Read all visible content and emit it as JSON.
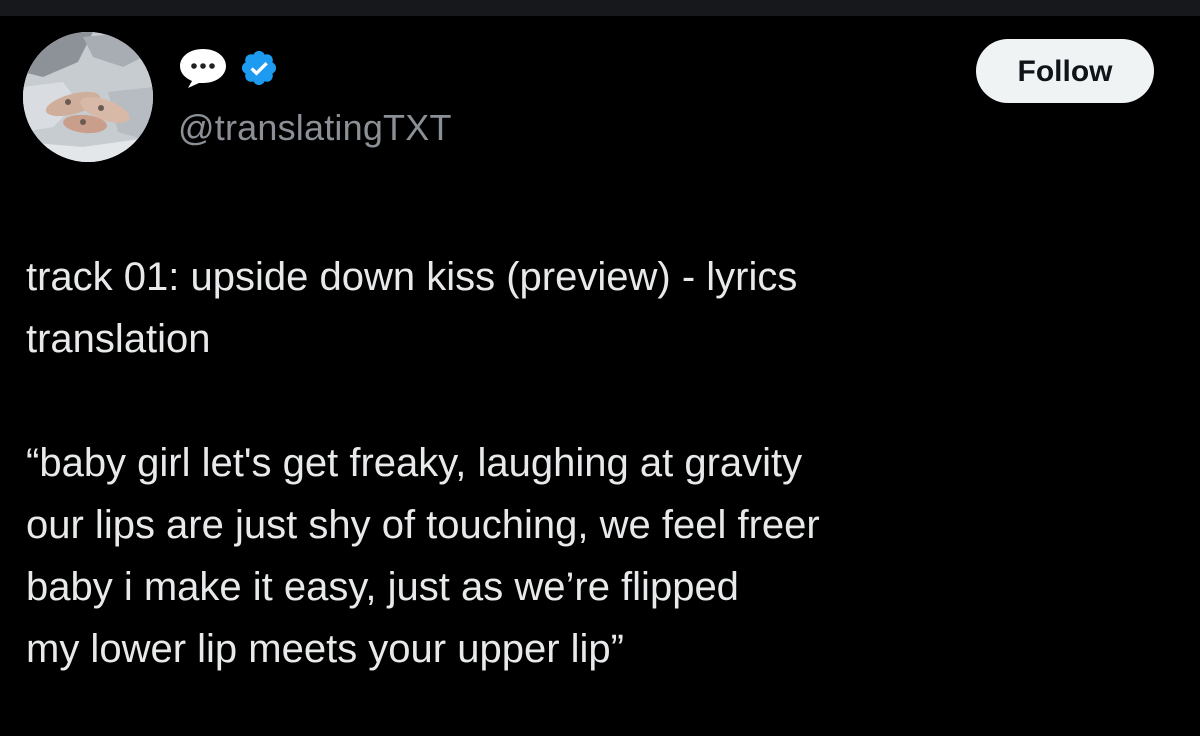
{
  "author": {
    "display_icon": "speech-bubble-icon",
    "verified_icon": "verified-badge-icon",
    "verified_color": "#1d9bf0",
    "handle": "@translatingTXT"
  },
  "actions": {
    "follow_label": "Follow"
  },
  "tweet": {
    "title_lines": [
      "track 01: upside down kiss (preview) - lyrics",
      "translation"
    ],
    "lyric_lines": [
      "“baby girl let's get freaky, laughing at gravity",
      "our lips are just shy of touching, we feel freer",
      "baby i make it easy, just as we’re flipped",
      "my lower lip meets your upper lip”"
    ]
  },
  "colors": {
    "background": "#000000",
    "text": "#e7e9ea",
    "muted": "#8b9096",
    "follow_bg": "#eff3f4"
  }
}
